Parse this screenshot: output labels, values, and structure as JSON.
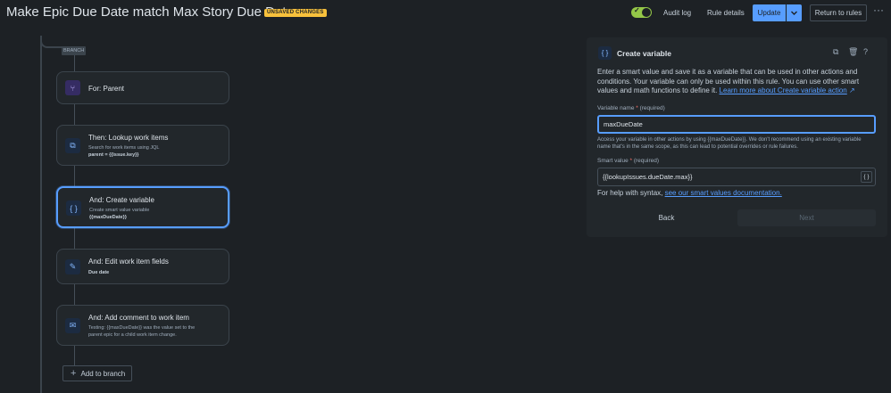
{
  "header": {
    "title": "Make Epic Due Date match Max Story Due Date",
    "badge": "UNSAVED CHANGES",
    "audit_log": "Audit log",
    "rule_details": "Rule details",
    "update": "Update",
    "return_to_rules": "Return to rules",
    "more": "···",
    "toggle_state": "on"
  },
  "flow": {
    "branch_label": "BRANCH",
    "cards": [
      {
        "title": "For: Parent",
        "sub1": "",
        "sub2": ""
      },
      {
        "title": "Then: Lookup work items",
        "sub1": "Search for work items using JQL",
        "sub2": "parent = {{issue.key}}"
      },
      {
        "title": "And: Create variable",
        "sub1": "Create smart value variable",
        "sub2": "{{maxDueDate}}"
      },
      {
        "title": "And: Edit work item fields",
        "sub1": "Due date",
        "sub2": ""
      },
      {
        "title": "And: Add comment to work item",
        "sub1": "Testing: {{maxDueDate}} was the value set to the",
        "sub2": "parent epic for a child work item change."
      }
    ],
    "add_to_branch": "Add to branch"
  },
  "panel": {
    "title": "Create variable",
    "description": "Enter a smart value and save it as a variable that can be used in other actions and conditions. Your variable can only be used within this rule. You can use other smart values and math functions to define it.",
    "learn_more": "Learn more about Create variable action",
    "variable_name_label": "Variable name",
    "required_text": "(required)",
    "variable_name_value": "maxDueDate",
    "helper_text": "Access your variable in other actions by using {{maxDueDate}}. We don't recommend using an existing variable name that's in the same scope, as this can lead to potential overrides or rule failures.",
    "smart_value_label": "Smart value",
    "smart_value_value": "{{lookupIssues.dueDate.max}}",
    "help_prefix": "For help with syntax,",
    "help_link": "see our smart values documentation.",
    "back": "Back",
    "next": "Next"
  }
}
